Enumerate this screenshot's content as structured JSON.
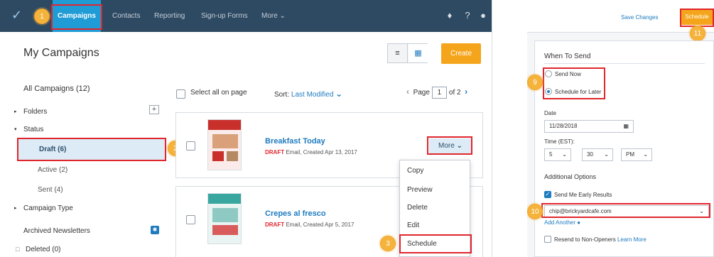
{
  "nav": {
    "logo": "✓",
    "items": [
      "Campaigns",
      "Contacts",
      "Reporting",
      "Sign-up Forms",
      "More ⌄"
    ]
  },
  "callouts": [
    "1",
    "2",
    "3",
    "9",
    "10",
    "11"
  ],
  "page": {
    "title": "My Campaigns",
    "create": "Create",
    "list_icon": "≡",
    "calendar_icon": "▦"
  },
  "sidebar": {
    "all": "All Campaigns (12)",
    "folders": "Folders",
    "folders_add": "+",
    "status": "Status",
    "draft": "Draft (6)",
    "active": "Active (2)",
    "sent": "Sent (4)",
    "campaign_type": "Campaign Type",
    "archived": "Archived Newsletters",
    "archived_icon": "✱",
    "deleted": "Deleted (0)"
  },
  "list": {
    "select_all": "Select all on page",
    "sort_label": "Sort: ",
    "sort_value": "Last Modified",
    "page_label": "Page",
    "page_current": "1",
    "page_total": "of 2"
  },
  "campaigns": [
    {
      "title": "Breakfast Today",
      "status": "DRAFT",
      "meta": " Email, Created Apr 13, 2017"
    },
    {
      "title": "Crepes al fresco",
      "status": "DRAFT",
      "meta": " Email, Created Apr 5, 2017"
    }
  ],
  "more_button": "More",
  "menu": [
    "Copy",
    "Preview",
    "Delete",
    "Edit",
    "Schedule"
  ],
  "scheduler": {
    "save_changes": "Save Changes",
    "schedule": "Schedule",
    "when_to_send": "When To Send",
    "send_now": "Send Now",
    "schedule_later": "Schedule for Later",
    "date_label": "Date",
    "date_value": "11/28/2018",
    "time_label": "Time (EST):",
    "hour": "5",
    "minute": "30",
    "ampm": "PM",
    "additional": "Additional Options",
    "early_results": "Send Me Early Results",
    "email": "chip@brickyardcafe.com",
    "add_another": "Add Another",
    "resend": "Resend to Non-Openers",
    "learn_more": "Learn More"
  },
  "colors": {
    "nav_bg": "#2e4a63",
    "accent_blue": "#1f9bd6",
    "link_blue": "#1f7bbf",
    "orange": "#f5a51c",
    "highlight_red": "#e0262d",
    "callout_yellow": "#f5b33c"
  }
}
